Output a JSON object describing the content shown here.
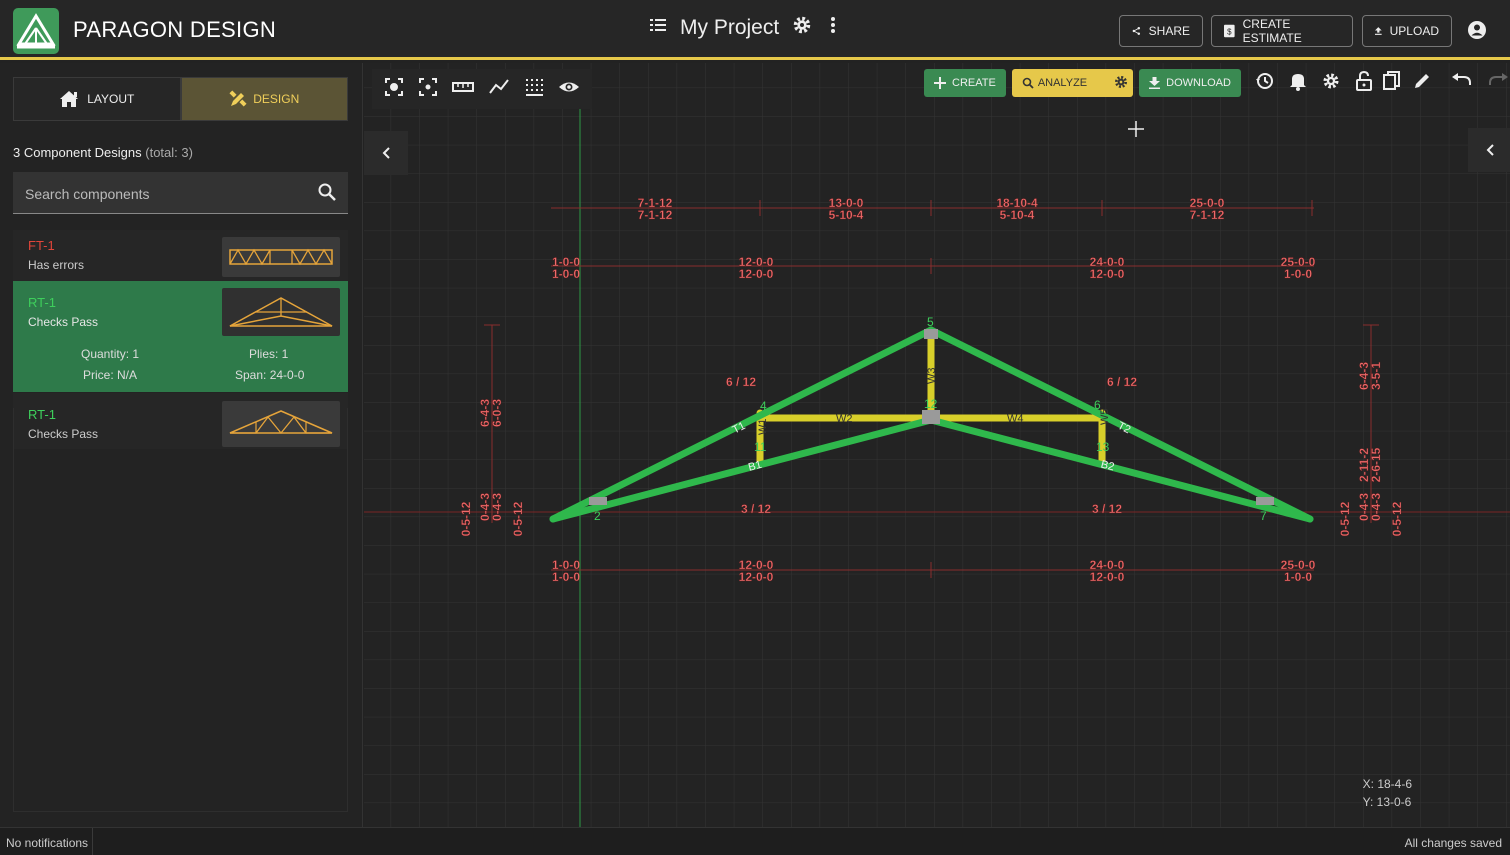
{
  "header": {
    "brand": "PARAGON DESIGN",
    "project_title": "My Project",
    "share_label": "SHARE",
    "estimate_label": "CREATE ESTIMATE",
    "upload_label": "UPLOAD"
  },
  "sidebar": {
    "tab_layout": "LAYOUT",
    "tab_design": "DESIGN",
    "count_label": "3 Component Designs",
    "count_total": "(total: 3)",
    "search_placeholder": "Search components",
    "components": [
      {
        "name": "FT-1",
        "status": "Has errors",
        "name_color": "#e0453a"
      },
      {
        "name": "RT-1",
        "status": "Checks Pass",
        "name_color": "#3ecf5c",
        "quantity": "Quantity: 1",
        "plies": "Plies: 1",
        "price": "Price: N/A",
        "span": "Span: 24-0-0"
      },
      {
        "name": "RT-1",
        "status": "Checks Pass",
        "name_color": "#3ecf5c"
      }
    ]
  },
  "toolbar": {
    "create_label": "CREATE",
    "analyze_label": "ANALYZE",
    "download_label": "DOWNLOAD"
  },
  "drawing": {
    "top_dims": [
      [
        "7-1-12",
        "7-1-12"
      ],
      [
        "13-0-0",
        "5-10-4"
      ],
      [
        "18-10-4",
        "5-10-4"
      ],
      [
        "25-0-0",
        "7-1-12"
      ]
    ],
    "mid_dims": [
      [
        "1-0-0",
        "1-0-0"
      ],
      [
        "12-0-0",
        "12-0-0"
      ],
      [
        "24-0-0",
        "12-0-0"
      ],
      [
        "25-0-0",
        "1-0-0"
      ]
    ],
    "bottom_dims": [
      [
        "1-0-0",
        "1-0-0"
      ],
      [
        "12-0-0",
        "12-0-0"
      ],
      [
        "24-0-0",
        "12-0-0"
      ],
      [
        "25-0-0",
        "1-0-0"
      ]
    ],
    "pitch_top_left": "6 / 12",
    "pitch_top_right": "6 / 12",
    "pitch_bot_left": "3 / 12",
    "pitch_bot_right": "3 / 12",
    "left_height": [
      "6-4-3",
      "6-0-3"
    ],
    "left_small": [
      "0-4-3",
      "0-4-3"
    ],
    "left_edge": "0-5-12",
    "left_edge2": "0-5-12",
    "right_height": [
      "6-4-3",
      "3-5-1"
    ],
    "right_mid": [
      "2-11-2",
      "2-6-15"
    ],
    "right_small": [
      "0-4-3",
      "0-4-3"
    ],
    "right_edge": "0-5-12",
    "right_edge2": "0-5-12",
    "members": [
      "T1",
      "T2",
      "B1",
      "B2",
      "W1",
      "W2",
      "W3",
      "W4",
      "W5"
    ],
    "joints": [
      "2",
      "4",
      "5",
      "6",
      "7",
      "11",
      "12",
      "13"
    ]
  },
  "cursor_coords": {
    "x": "X: 18-4-6",
    "y": "Y: 13-0-6"
  },
  "footer": {
    "notifications": "No notifications",
    "save_status": "All changes saved"
  },
  "colors": {
    "accent": "#e6c84a",
    "green": "#2fb84c",
    "yellow": "#d8cf2a",
    "dim_red": "#f06a6a"
  }
}
